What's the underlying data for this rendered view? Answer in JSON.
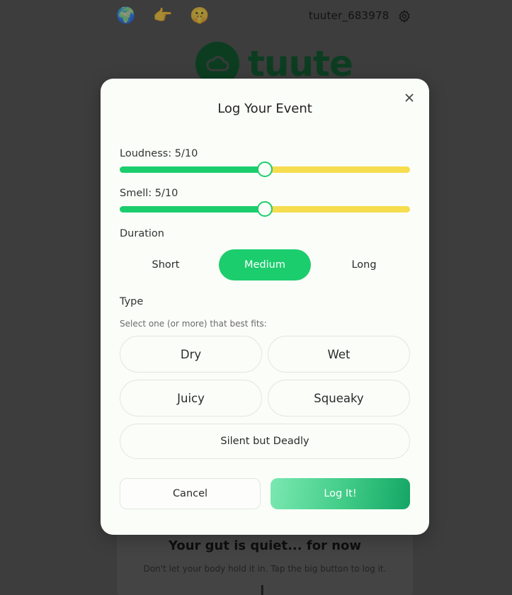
{
  "topbar": {
    "emoji_globe": "🌍",
    "emoji_point": "👉",
    "emoji_face": "🤫",
    "username": "tuuter_683978"
  },
  "logo": {
    "word": "tuute"
  },
  "background": {
    "quiet_title": "Your gut is quiet... for now",
    "quiet_sub": "Don't let your body hold it in. Tap the big button to log it."
  },
  "modal": {
    "title": "Log Your Event",
    "loudness": {
      "label": "Loudness: 5/10",
      "value": 5,
      "max": 10
    },
    "smell": {
      "label": "Smell: 5/10",
      "value": 5,
      "max": 10
    },
    "duration": {
      "label": "Duration",
      "options": [
        "Short",
        "Medium",
        "Long"
      ],
      "selected": "Medium"
    },
    "type": {
      "label": "Type",
      "helper": "Select one (or more) that best fits:",
      "options": [
        "Dry",
        "Wet",
        "Juicy",
        "Squeaky",
        "Silent but Deadly"
      ]
    },
    "cancel_label": "Cancel",
    "submit_label": "Log It!"
  },
  "colors": {
    "accent_green": "#1ccd6d",
    "slider_rest": "#f5dd4e",
    "brand_dark": "#0c3d21"
  }
}
